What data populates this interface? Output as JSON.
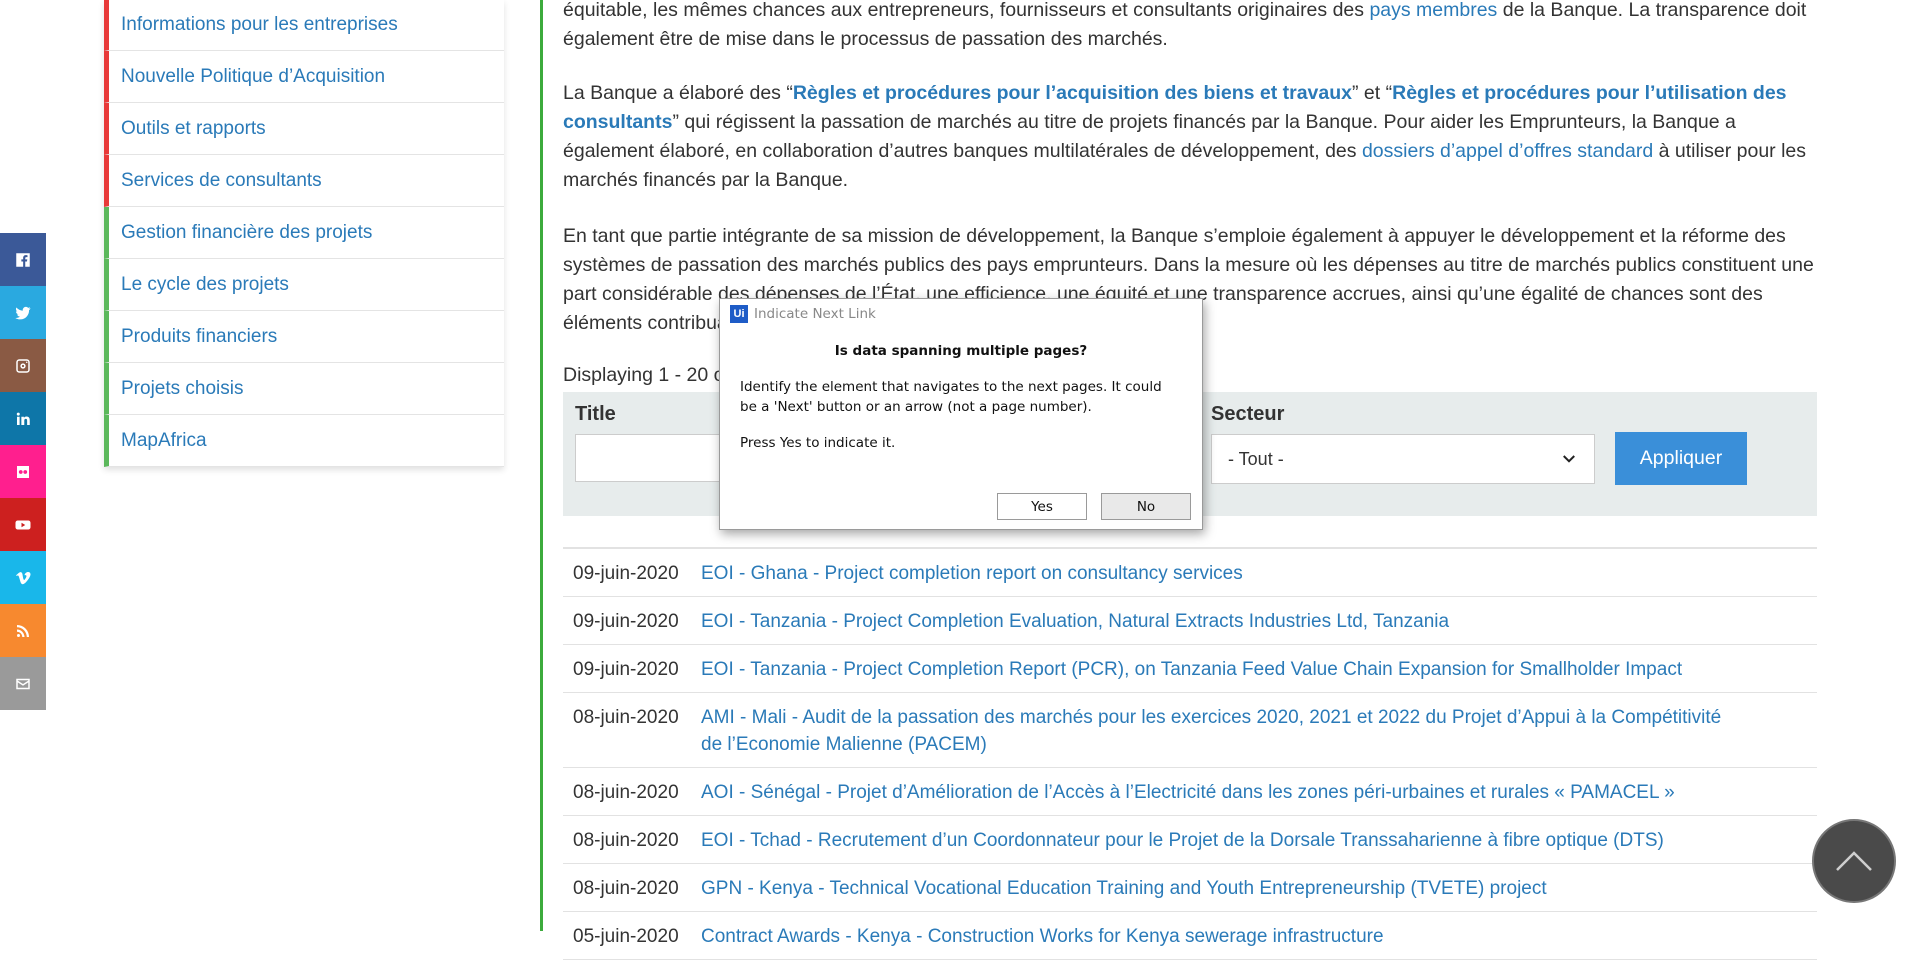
{
  "social": [
    {
      "icon": "facebook-icon",
      "color": "#3b5998"
    },
    {
      "icon": "twitter-icon",
      "color": "#2aa9e0"
    },
    {
      "icon": "instagram-icon",
      "color": "#8a5a44"
    },
    {
      "icon": "linkedin-icon",
      "color": "#0e76a8"
    },
    {
      "icon": "flickr-icon",
      "color": "#ff1f8e"
    },
    {
      "icon": "youtube-icon",
      "color": "#cd201f"
    },
    {
      "icon": "vimeo-icon",
      "color": "#19b7ea"
    },
    {
      "icon": "rss-icon",
      "color": "#f7892f"
    },
    {
      "icon": "email-icon",
      "color": "#9a9a9a"
    }
  ],
  "sidebar": {
    "items": [
      {
        "label": "Informations pour les entreprises",
        "accent": "red"
      },
      {
        "label": "Nouvelle Politique d’Acquisition",
        "accent": "red"
      },
      {
        "label": "Outils et rapports",
        "accent": "red"
      },
      {
        "label": "Services de consultants",
        "accent": "red"
      },
      {
        "label": "Gestion financière des projets",
        "accent": "green"
      },
      {
        "label": "Le cycle des projets",
        "accent": "green"
      },
      {
        "label": "Produits financiers",
        "accent": "green"
      },
      {
        "label": "Projets choisis",
        "accent": "green"
      },
      {
        "label": "MapAfrica",
        "accent": "green"
      }
    ]
  },
  "content": {
    "p1_a": "équitable, les mêmes chances aux entrepreneurs, fournisseurs et consultants originaires des ",
    "p1_link": "pays membres",
    "p1_b": " de la Banque. La transparence doit également être de mise dans le processus de passation des marchés.",
    "p2_a": "La Banque a élaboré des “",
    "p2_link1": "Règles et procédures pour l’acquisition des biens et travaux",
    "p2_b": "” et “",
    "p2_link2": "Règles et procédures pour l’utilisation des consultants",
    "p2_c": "” qui régissent la passation de marchés au titre de projets financés par la Banque. Pour aider les Emprunteurs, la Banque a également élaboré, en collaboration d’autres banques multilatérales de développement, des ",
    "p2_link3": "dossiers d’appel d’offres standard",
    "p2_d": " à utiliser pour les marchés financés par la Banque.",
    "p3": "En tant que partie intégrante de sa mission de développement, la Banque s’emploie également à appuyer le développement et la réforme des systèmes de passation des marchés publics des pays emprunteurs. Dans la mesure où les dépenses au titre de marchés publics constituent une part considérable des dépenses de l’État, une efficience, une équité et une transparence accrues, ainsi qu’une égalité de chances sont des éléments contribuant à la croissance et à la réduction de la pauvreté."
  },
  "displaying": "Displaying 1 - 20 o",
  "filter": {
    "title_label": "Title",
    "secteur_label": "Secteur",
    "secteur_value": "- Tout -",
    "apply_label": "Appliquer"
  },
  "results": [
    {
      "date": "09-juin-2020",
      "title": "EOI - Ghana - Project completion report on consultancy services"
    },
    {
      "date": "09-juin-2020",
      "title": "EOI - Tanzania - Project Completion Evaluation, Natural Extracts Industries Ltd, Tanzania"
    },
    {
      "date": "09-juin-2020",
      "title": "EOI - Tanzania - Project Completion Report (PCR), on Tanzania Feed Value Chain Expansion for Smallholder Impact"
    },
    {
      "date": "08-juin-2020",
      "title": "AMI - Mali - Audit de la passation des marchés pour les exercices 2020, 2021 et 2022 du Projet d’Appui à la Compétitivité de l’Economie Malienne (PACEM)"
    },
    {
      "date": "08-juin-2020",
      "title": "AOI - Sénégal - Projet d’Amélioration de l’Accès à l’Electricité dans les zones péri-urbaines et rurales « PAMACEL »"
    },
    {
      "date": "08-juin-2020",
      "title": "EOI - Tchad - Recrutement d’un Coordonnateur pour le Projet de la Dorsale Transsaharienne à fibre optique (DTS)"
    },
    {
      "date": "08-juin-2020",
      "title": "GPN - Kenya - Technical Vocational Education Training and Youth Entrepreneurship (TVETE) project"
    },
    {
      "date": "05-juin-2020",
      "title": "Contract Awards - Kenya - Construction Works for Kenya sewerage infrastructure"
    }
  ],
  "dialog": {
    "logo": "Ui",
    "title": "Indicate Next Link",
    "question": "Is data spanning multiple pages?",
    "message": "Identify the element that navigates to the next pages. It could be a 'Next' button or an arrow (not a page number).",
    "prompt": "Press Yes to indicate it.",
    "yes_label": "Yes",
    "no_label": "No"
  },
  "colors": {
    "accent_red": "#e83a3a",
    "accent_green": "#5cb85c",
    "link": "#2a7ab8",
    "apply_button": "#3a8fd9"
  }
}
